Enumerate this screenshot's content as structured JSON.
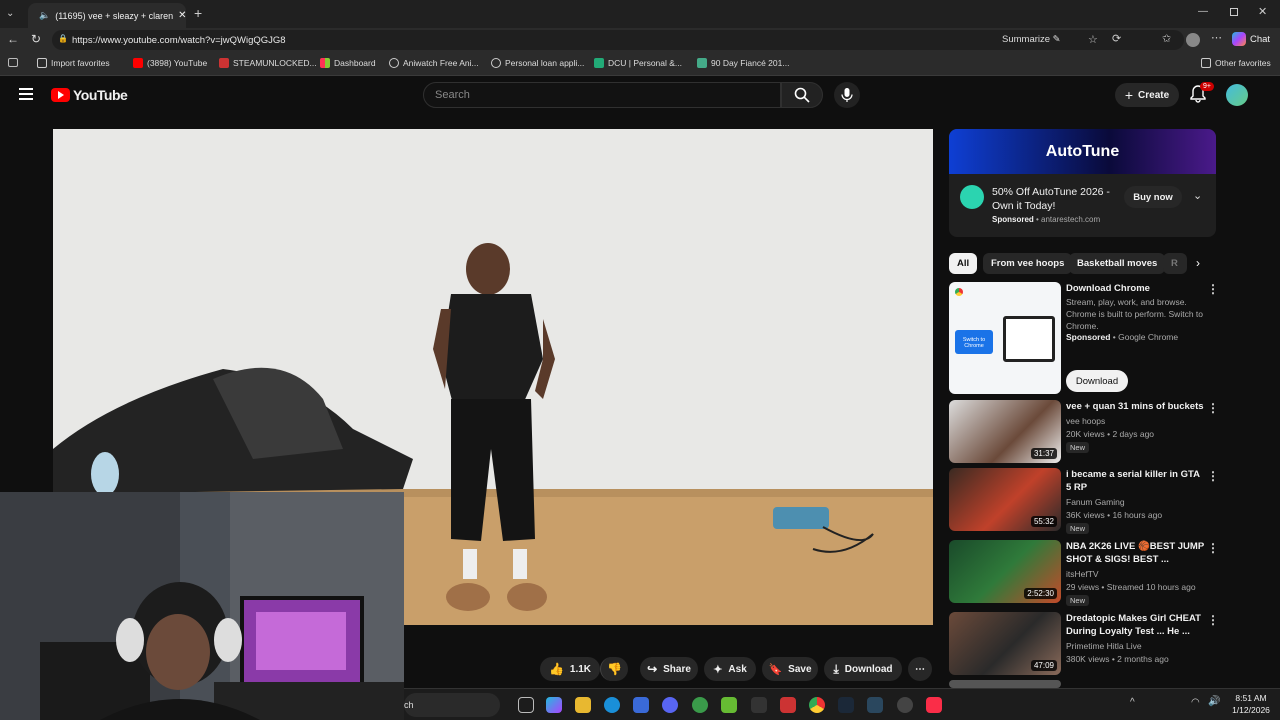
{
  "browser": {
    "tab_title": "(11695) vee + sleazy + claren",
    "url": "https://www.youtube.com/watch?v=jwQWigQGJG8",
    "summarize_label": "Summarize",
    "chat_label": "Chat",
    "favorites": [
      "Import favorites",
      "(3898) YouTube",
      "STEAMUNLOCKED...",
      "Dashboard",
      "Aniwatch Free Ani...",
      "Personal loan appli...",
      "DCU | Personal &...",
      "90 Day Fiancé 201..."
    ],
    "other_favorites": "Other favorites"
  },
  "youtube": {
    "logo_text": "YouTube",
    "search_placeholder": "Search",
    "create_label": "Create",
    "notif_count": "9+"
  },
  "actions": {
    "like_count": "1.1K",
    "share": "Share",
    "ask": "Ask",
    "save": "Save",
    "download": "Download"
  },
  "ad": {
    "banner": "AutoTune",
    "title": "50% Off AutoTune 2026 - Own it Today!",
    "sponsored": "Sponsored",
    "domain": "antarestech.com",
    "cta": "Buy now"
  },
  "chips": [
    "All",
    "From vee hoops",
    "Basketball moves",
    "R"
  ],
  "recs": {
    "promo": {
      "title": "Download Chrome",
      "desc": "Stream, play, work, and browse. Chrome is built to perform. Switch to Chrome.",
      "sponsored": "Sponsored",
      "by": "Google Chrome",
      "cta": "Download",
      "thumb_switch": "Switch to Chrome"
    },
    "items": [
      {
        "title": "vee + quan 31 mins of buckets",
        "channel": "vee hoops",
        "meta": "20K views • 2 days ago",
        "badge": "New",
        "duration": "31:37"
      },
      {
        "title": "i became a serial killer in GTA 5 RP",
        "channel": "Fanum Gaming",
        "meta": "36K views • 16 hours ago",
        "badge": "New",
        "duration": "55:32"
      },
      {
        "title": "NBA 2K26 LIVE 🏀BEST JUMP SHOT & SIGS! BEST ...",
        "channel": "itsHefTV",
        "meta": "29 views • Streamed 10 hours ago",
        "badge": "New",
        "duration": "2:52:30"
      },
      {
        "title": "Dredatopic Makes Girl CHEAT During Loyalty Test ... He ...",
        "channel": "Primetime Hitla Live",
        "meta": "380K views • 2 months ago",
        "badge": "",
        "duration": "47:09"
      }
    ]
  },
  "taskbar": {
    "search_partial": "ch",
    "time": "8:51 AM",
    "date": "1/12/2026"
  },
  "colors": {
    "yt_red": "#ff0000",
    "background": "#0f0f0f",
    "accent_blue": "#3ea6ff"
  }
}
